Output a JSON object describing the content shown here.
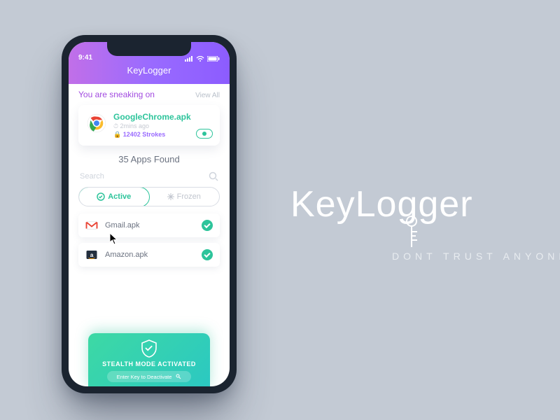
{
  "brand": {
    "name_prefix": "Key",
    "name_suffix": "Logger",
    "tagline": "DONT TRUST ANYONE"
  },
  "statusbar": {
    "time": "9:41"
  },
  "header": {
    "title": "KeyLogger"
  },
  "sneaking": {
    "label": "You are sneaking on",
    "view_all": "View All"
  },
  "featured": {
    "name": "GoogleChrome.apk",
    "time": "2mins ago",
    "strokes": "12402 Strokes"
  },
  "apps_found": "35 Apps Found",
  "search": {
    "placeholder": "Search"
  },
  "tabs": {
    "active": "Active",
    "frozen": "Frozen"
  },
  "apps": [
    {
      "name": "Gmail.apk"
    },
    {
      "name": "Amazon.apk"
    }
  ],
  "stealth": {
    "title": "STEALTH MODE ACTIVATED",
    "hint": "Enter Key to Deactivate"
  }
}
